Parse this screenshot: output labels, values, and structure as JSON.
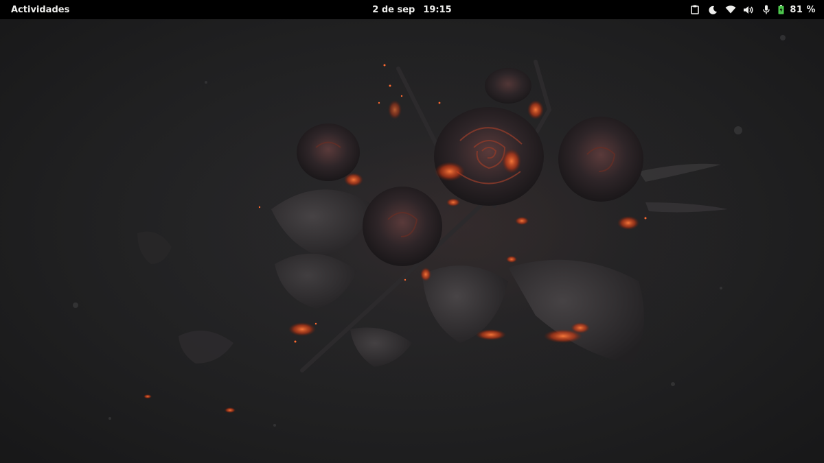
{
  "topbar": {
    "activities_label": "Actividades",
    "date": "2 de sep",
    "time": "19:15",
    "battery_percent": "81 %",
    "status_icons": [
      "clipboard-icon",
      "night-light-icon",
      "wifi-icon",
      "volume-icon",
      "microphone-icon",
      "battery-icon"
    ]
  },
  "desktop": {
    "wallpaper": "burning-roses-wallpaper"
  },
  "colors": {
    "topbar_bg": "#000000",
    "topbar_text": "#eeeeec",
    "battery_green": "#4ec94e",
    "ember": "#ff5a2a"
  }
}
